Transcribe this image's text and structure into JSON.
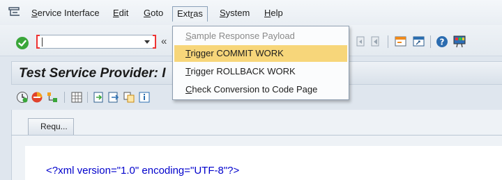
{
  "menu": {
    "items": [
      {
        "mnemonic": "S",
        "rest": "ervice Interface"
      },
      {
        "mnemonic": "E",
        "rest": "dit"
      },
      {
        "mnemonic": "G",
        "rest": "oto"
      },
      {
        "prefix": "Ext",
        "mnemonic": "r",
        "rest": "as"
      },
      {
        "mnemonic": "S",
        "rest": "ystem"
      },
      {
        "mnemonic": "H",
        "rest": "elp"
      }
    ]
  },
  "toolbar": {
    "command_field_value": "",
    "collapse_glyph": "«"
  },
  "title": "Test Service Provider: I",
  "tab": {
    "label": "Requ..."
  },
  "content": {
    "xml_line": "<?xml version=\"1.0\" encoding=\"UTF-8\"?>"
  },
  "extras_menu": {
    "items": [
      {
        "mnemonic": "S",
        "rest": "ample Response Payload",
        "state": "disabled"
      },
      {
        "mnemonic": "T",
        "rest": "rigger COMMIT WORK",
        "state": "highlighted"
      },
      {
        "mnemonic": "T",
        "rest": "rigger ROLLBACK WORK",
        "state": "normal"
      },
      {
        "mnemonic": "C",
        "rest": "heck Conversion to Code Page",
        "state": "normal"
      }
    ]
  },
  "colors": {
    "highlight": "#f7d67a",
    "ok_green": "#3aa63a",
    "xml_blue": "#0000cc",
    "focus_red": "#e33333"
  }
}
